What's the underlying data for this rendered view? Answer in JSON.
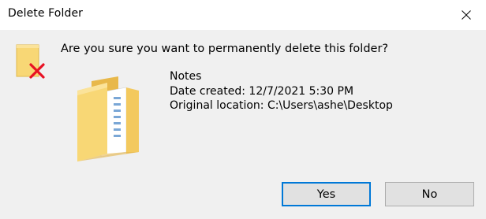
{
  "window": {
    "title": "Delete Folder",
    "close_icon": "close-x-icon"
  },
  "message": {
    "question": "Are you sure you want to permanently delete this folder?",
    "warning_icon": "delete-folder-warning-icon",
    "folder_icon": "folder-icon"
  },
  "item": {
    "name": "Notes",
    "date_created": "Date created: 12/7/2021 5:30 PM",
    "original_location": "Original location: C:\\Users\\ashe\\Desktop"
  },
  "buttons": {
    "yes_label": "Yes",
    "no_label": "No"
  },
  "colors": {
    "accent": "#0078d7",
    "folder": "#f8d775",
    "delete_red": "#e81123"
  }
}
